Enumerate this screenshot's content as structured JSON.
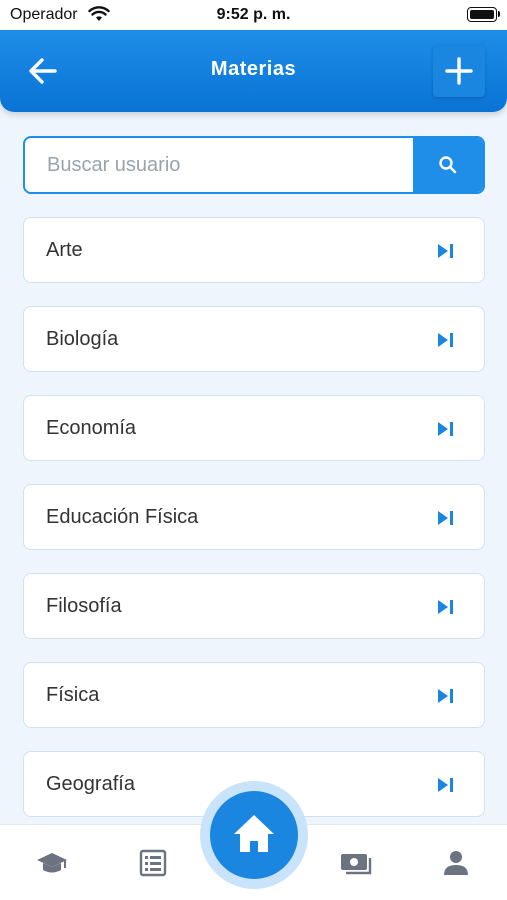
{
  "status_bar": {
    "carrier": "Operador",
    "time": "9:52 p. m."
  },
  "header": {
    "title": "Materias"
  },
  "search": {
    "placeholder": "Buscar usuario"
  },
  "subjects": [
    {
      "label": "Arte"
    },
    {
      "label": "Biología"
    },
    {
      "label": "Economía"
    },
    {
      "label": "Educación Física"
    },
    {
      "label": "Filosofía"
    },
    {
      "label": "Física"
    },
    {
      "label": "Geografía"
    }
  ],
  "bottom_nav": [
    "graduation-cap-icon",
    "list-icon",
    "home-icon",
    "money-icon",
    "user-icon"
  ],
  "colors": {
    "primary": "#1e8ee8",
    "background": "#eef5fd",
    "nav_icon": "#6b7280"
  }
}
